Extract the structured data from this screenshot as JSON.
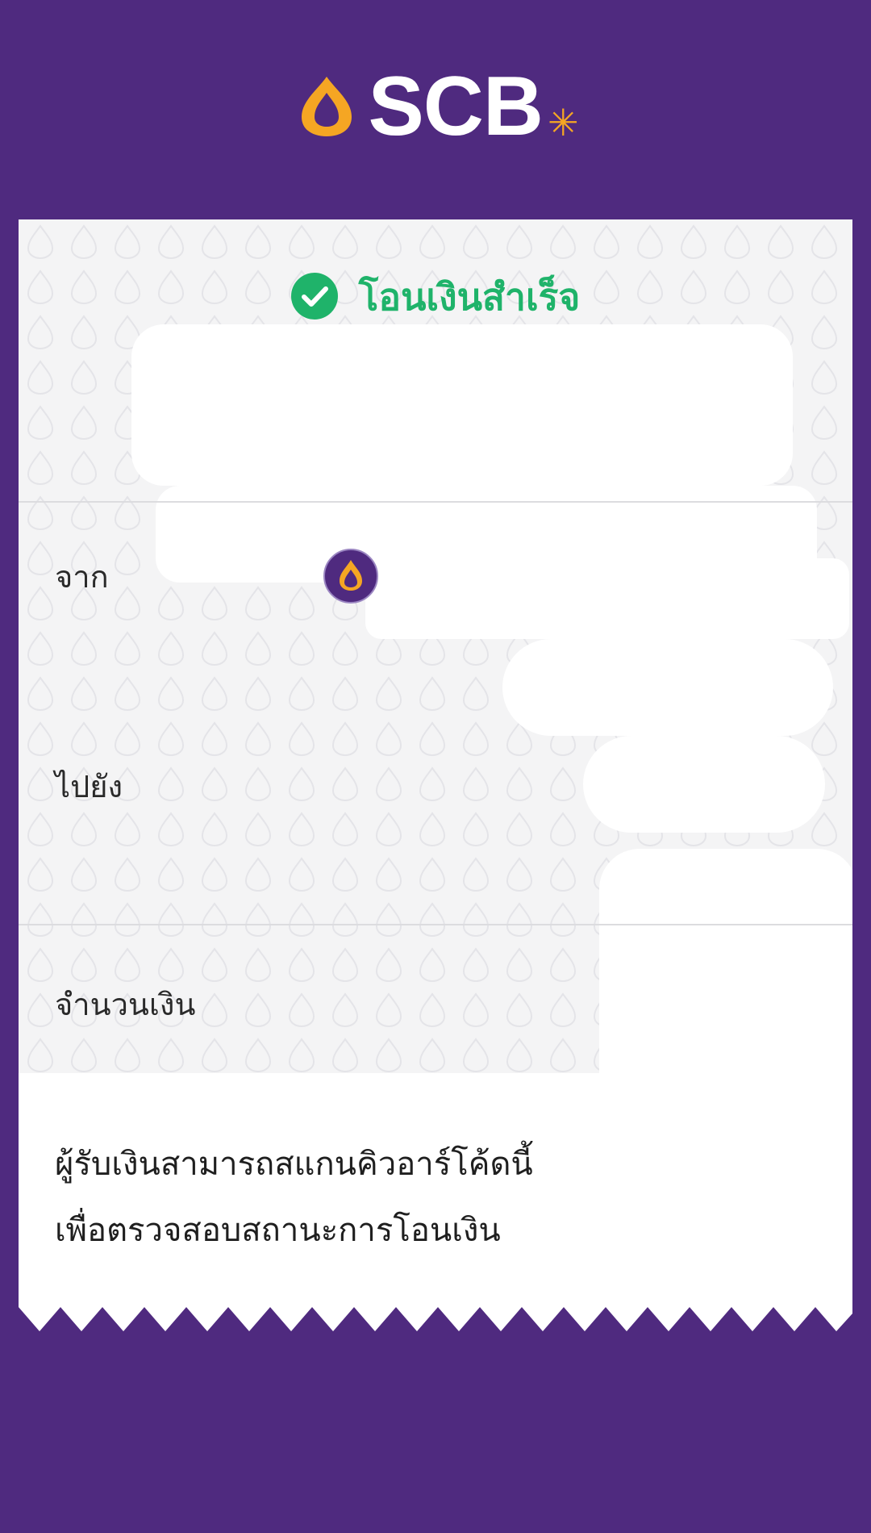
{
  "brand": {
    "name": "SCB",
    "logo_icon": "scb-emblem-icon",
    "accent": "#f5a623",
    "background": "#4f2a7f"
  },
  "status": {
    "title": "โอนเงินสำเร็จ",
    "icon": "check-circle-icon",
    "color": "#1fb36a"
  },
  "rows": {
    "from_label": "จาก",
    "to_label": "ไปยัง",
    "amount_label": "จำนวนเงิน"
  },
  "qr_note": {
    "line1": "ผู้รับเงินสามารถสแกนคิวอาร์โค้ดนี้",
    "line2": "เพื่อตรวจสอบสถานะการโอนเงิน"
  }
}
